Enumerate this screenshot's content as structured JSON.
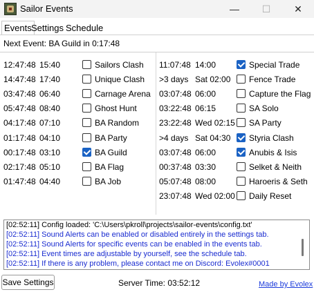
{
  "window": {
    "title": "Sailor Events",
    "min": "—",
    "max": "☐",
    "close": "✕"
  },
  "tabs": [
    "Events",
    "Settings",
    "Schedule"
  ],
  "next_event": "Next Event: BA Guild in 0:17:48",
  "left_events": [
    {
      "countdown": "12:47:48",
      "time": "15:40",
      "checked": false,
      "name": "Sailors Clash"
    },
    {
      "countdown": "14:47:48",
      "time": "17:40",
      "checked": false,
      "name": "Unique Clash"
    },
    {
      "countdown": "03:47:48",
      "time": "06:40",
      "checked": false,
      "name": "Carnage Arena"
    },
    {
      "countdown": "05:47:48",
      "time": "08:40",
      "checked": false,
      "name": "Ghost Hunt"
    },
    {
      "countdown": "04:17:48",
      "time": "07:10",
      "checked": false,
      "name": "BA Random"
    },
    {
      "countdown": "01:17:48",
      "time": "04:10",
      "checked": false,
      "name": "BA Party"
    },
    {
      "countdown": "00:17:48",
      "time": "03:10",
      "checked": true,
      "name": "BA Guild"
    },
    {
      "countdown": "02:17:48",
      "time": "05:10",
      "checked": false,
      "name": "BA Flag"
    },
    {
      "countdown": "01:47:48",
      "time": "04:40",
      "checked": false,
      "name": "BA Job"
    }
  ],
  "right_events": [
    {
      "countdown": "11:07:48",
      "time": "14:00",
      "checked": true,
      "name": "Special Trade"
    },
    {
      "countdown": ">3 days",
      "time": "Sat 02:00",
      "checked": false,
      "name": "Fence Trade"
    },
    {
      "countdown": "03:07:48",
      "time": "06:00",
      "checked": false,
      "name": "Capture the Flag"
    },
    {
      "countdown": "03:22:48",
      "time": "06:15",
      "checked": false,
      "name": "SA Solo"
    },
    {
      "countdown": "23:22:48",
      "time": "Wed 02:15",
      "checked": false,
      "name": "SA Party"
    },
    {
      "countdown": ">4 days",
      "time": "Sat 04:30",
      "checked": true,
      "name": "Styria Clash"
    },
    {
      "countdown": "03:07:48",
      "time": "06:00",
      "checked": true,
      "name": "Anubis & Isis"
    },
    {
      "countdown": "00:37:48",
      "time": "03:30",
      "checked": false,
      "name": "Selket & Neith"
    },
    {
      "countdown": "05:07:48",
      "time": "08:00",
      "checked": false,
      "name": "Haroeris & Seth"
    },
    {
      "countdown": "23:07:48",
      "time": "Wed 02:00",
      "checked": false,
      "name": "Daily Reset"
    }
  ],
  "log": [
    {
      "text": "[02:52:11] Config loaded: 'C:\\Users\\pkroll\\projects\\sailor-events\\config.txt'",
      "color": "black"
    },
    {
      "text": "[02:52:11] Sound Alerts can be enabled or disabled entirely in the settings tab.",
      "color": "blue"
    },
    {
      "text": "[02:52:11] Sound Alerts for specific events can be enabled in the events tab.",
      "color": "blue"
    },
    {
      "text": "[02:52:11] Event times are adjustable by yourself, see the schedule tab.",
      "color": "blue"
    },
    {
      "text": "[02:52:11] If there is any problem, please contact me on Discord: Evolex#0001",
      "color": "blue"
    }
  ],
  "footer": {
    "save_label": "Save Settings",
    "server_time": "Server Time: 03:52:12",
    "made_by": "Made by Evolex"
  }
}
